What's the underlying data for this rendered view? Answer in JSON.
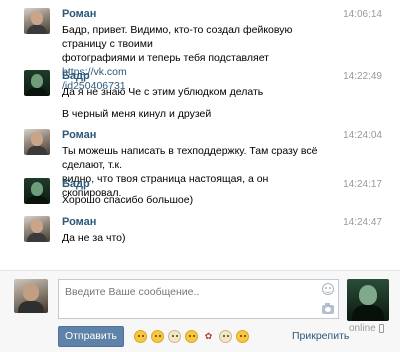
{
  "messages": [
    {
      "author": "Роман",
      "avatar": "roman",
      "time": "14:06:14",
      "lines": [
        "Бадр, привет. Видимо, кто-то создал фейковую страницу с твоими",
        "фотографиями и теперь тебя подставляет "
      ],
      "link": "https://vk.com",
      "link_line2": "/id250406731"
    },
    {
      "author": "Бадр",
      "avatar": "badr",
      "time": "14:22:49",
      "lines": [
        "Да я не знаю Че с этим ублюдком делать",
        "",
        "В черный меня кинул и друзей"
      ]
    },
    {
      "author": "Роман",
      "avatar": "roman",
      "time": "14:24:04",
      "lines": [
        "Ты можешь написать в техподдержку. Там сразу всё сделают, т.к.",
        "видно, что твоя страница настоящая, а он скопировал."
      ]
    },
    {
      "author": "Бадр",
      "avatar": "badr",
      "time": "14:24:17",
      "lines": [
        "Хорошо спасибо большое)"
      ]
    },
    {
      "author": "Роман",
      "avatar": "roman",
      "time": "14:24:47",
      "lines": [
        "Да не за что)"
      ]
    }
  ],
  "composer": {
    "placeholder": "Введите Ваше сообщение..",
    "send_label": "Отправить",
    "attach_label": "Прикрепить",
    "status": "online",
    "emojis": [
      "smile",
      "grin",
      "blush",
      "wink",
      "rose",
      "laugh",
      "surprised"
    ]
  },
  "colors": {
    "link": "#2b587a",
    "button": "#5e82a8",
    "time": "#999999"
  }
}
